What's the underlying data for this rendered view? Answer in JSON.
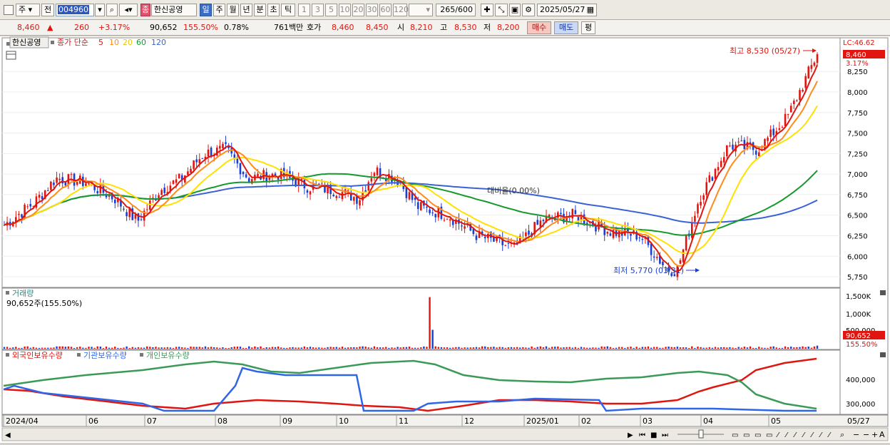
{
  "toolbar": {
    "period_select": "주",
    "prev_label": "전",
    "stock_code": "004960",
    "stock_name": "한신공영",
    "stock_tag": "종",
    "intervals": [
      "일",
      "주",
      "월",
      "년",
      "분",
      "초",
      "틱"
    ],
    "active_interval": "일",
    "minute_buttons": [
      "1",
      "3",
      "5",
      "10",
      "20",
      "30",
      "60",
      "120"
    ],
    "count_value": "265",
    "count_total": "/600",
    "date_value": "2025/05/27"
  },
  "quote": {
    "price": "8,460",
    "change": "260",
    "change_pct": "+3.17%",
    "volume": "90,652",
    "volume_pct": "155.50%",
    "turnover_pct": "0.78%",
    "amount": "761백만",
    "ask_label": "호가",
    "ask": "8,460",
    "bid": "8,450",
    "open_label": "시",
    "open": "8,210",
    "high_label": "고",
    "high": "8,530",
    "low_label": "저",
    "low": "8,200",
    "buy_label": "매수",
    "sell_label": "매도",
    "avg_label": "평"
  },
  "colors": {
    "up": "#e0150f",
    "down": "#1a3fd0",
    "ma5": "#e0150f",
    "ma10": "#ff8c1a",
    "ma20": "#ffe100",
    "ma60": "#149a2c",
    "ma120": "#3a62d6",
    "foreign": "#e0150f",
    "institution": "#2f66e8",
    "individual": "#3a9a56"
  },
  "price_panel": {
    "legend_name": "한신공영",
    "legend_type": "종가 단순",
    "ma_labels": [
      "5",
      "10",
      "20",
      "60",
      "120"
    ],
    "lc_label": "LC:46.62",
    "price_tag": "8,460",
    "pct_tag": "3.17%",
    "high_annotation": "최고 8,530 (05/27)",
    "low_annotation": "최저 5,770 (03/31)",
    "mid_annotation": "대비율(0.00%)"
  },
  "volume_panel": {
    "title": "거래량",
    "value_text": "90,652주(155.50%)",
    "tag_value": "90,652",
    "tag_pct": "155.50%",
    "ticks": [
      "1,500K",
      "1,000K",
      "500,000"
    ]
  },
  "flow_panel": {
    "legend": [
      "외국인보유수량",
      "기관보유수량",
      "개인보유수량"
    ],
    "ticks": [
      "400,000",
      "300,000"
    ]
  },
  "x_axis": {
    "labels": [
      "2024/04",
      "06",
      "07",
      "08",
      "09",
      "10",
      "11",
      "12",
      "2025/01",
      "02",
      "03",
      "04",
      "05"
    ],
    "right_label": "05/27"
  },
  "chart_data": {
    "type": "candlestick",
    "price_ticks": [
      "8,250",
      "8,000",
      "7,750",
      "7,500",
      "7,250",
      "7,000",
      "6,750",
      "6,500",
      "6,250",
      "6,000",
      "5,750"
    ],
    "price_range": [
      5620,
      8660
    ],
    "last_close": 8460,
    "high": 8530,
    "low": 5770,
    "ma5_last": 8000,
    "ma10_last": 7850,
    "ma20_last": 7560,
    "ma60_last": 6760,
    "ma120_last": 6620,
    "volume_spike": 1500000,
    "volume_last": 90652
  }
}
